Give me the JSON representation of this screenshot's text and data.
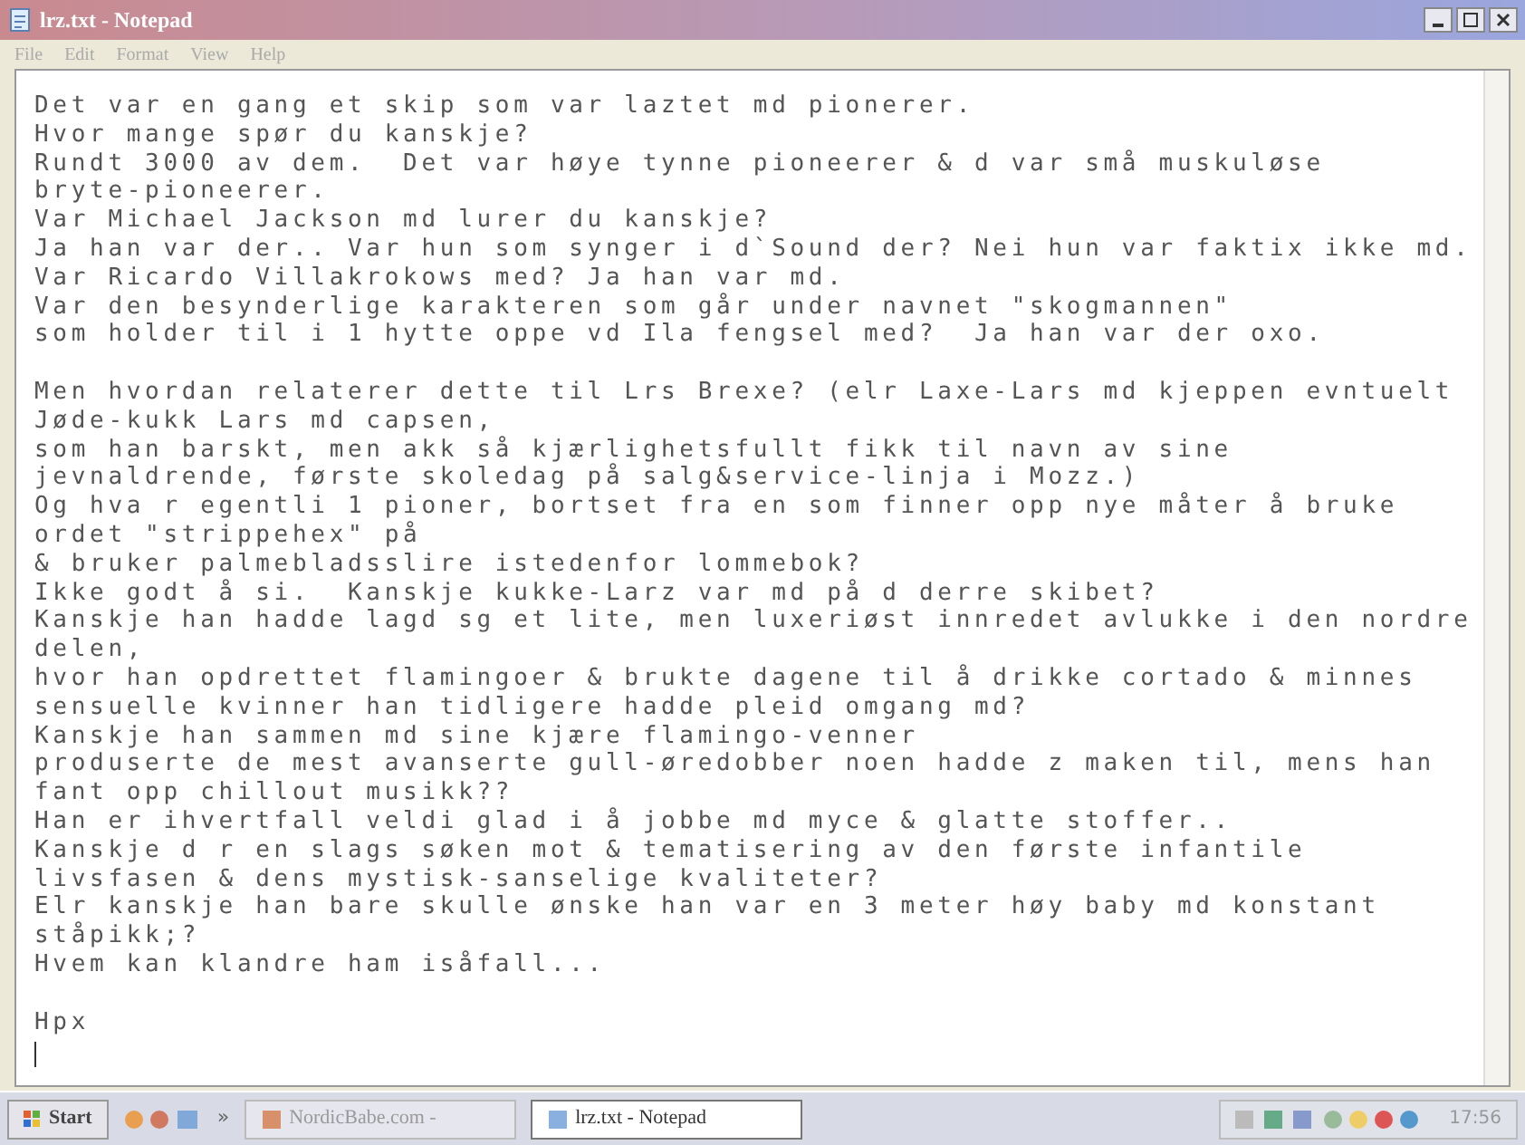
{
  "window": {
    "title": "lrz.txt - Notepad"
  },
  "menu": [
    "File",
    "Edit",
    "Format",
    "View",
    "Help"
  ],
  "document": {
    "paragraphs": [
      [
        "Det var en gang et skip som var laztet md pionerer.",
        "Hvor mange spør du kanskje?",
        "Rundt 3000 av dem.  Det var høye tynne pioneerer & d var små muskuløse",
        "bryte-pioneerer.",
        "Var Michael Jackson md lurer du kanskje?",
        "Ja han var der.. Var hun som synger i d`Sound der? Nei hun var faktix ikke md.",
        "Var Ricardo Villakrokows med? Ja han var md.",
        "Var den besynderlige karakteren som går under navnet \"skogmannen\"",
        "som holder til i 1 hytte oppe vd Ila fengsel med?  Ja han var der oxo."
      ],
      [
        "Men hvordan relaterer dette til Lrs Brexe? (elr Laxe-Lars md kjeppen evntuelt",
        "Jøde-kukk Lars md capsen,",
        "som han barskt, men akk så kjærlighetsfullt fikk til navn av sine",
        "jevnaldrende, første skoledag på salg&service-linja i Mozz.)",
        "Og hva r egentli 1 pioner, bortset fra en som finner opp nye måter å bruke",
        "ordet \"strippehex\" på",
        "& bruker palmebladsslire istedenfor lommebok?",
        "Ikke godt å si.  Kanskje kukke-Larz var md på d derre skibet?",
        "Kanskje han hadde lagd sg et lite, men luxeriøst innredet avlukke i den nordre",
        "delen,",
        "hvor han opdrettet flamingoer & brukte dagene til å drikke cortado & minnes",
        "sensuelle kvinner han tidligere hadde pleid omgang md?",
        "Kanskje han sammen md sine kjære flamingo-venner",
        "produserte de mest avanserte gull-øredobber noen hadde z maken til, mens han",
        "fant opp chillout musikk??",
        "Han er ihvertfall veldi glad i å jobbe md myce & glatte stoffer..",
        "Kanskje d r en slags søken mot & tematisering av den første infantile",
        "livsfasen & dens mystisk-sanselige kvaliteter?",
        "Elr kanskje han bare skulle ønske han var en 3 meter høy baby md konstant",
        "ståpikk;?",
        "Hvem kan klandre ham isåfall..."
      ],
      [
        "Hpx"
      ]
    ]
  },
  "taskbar": {
    "start": "Start",
    "more": "»",
    "buttons": [
      {
        "label": "NordicBabe.com -",
        "selected": false
      },
      {
        "label": "lrz.txt - Notepad",
        "selected": true
      }
    ],
    "clock": "17:56"
  }
}
